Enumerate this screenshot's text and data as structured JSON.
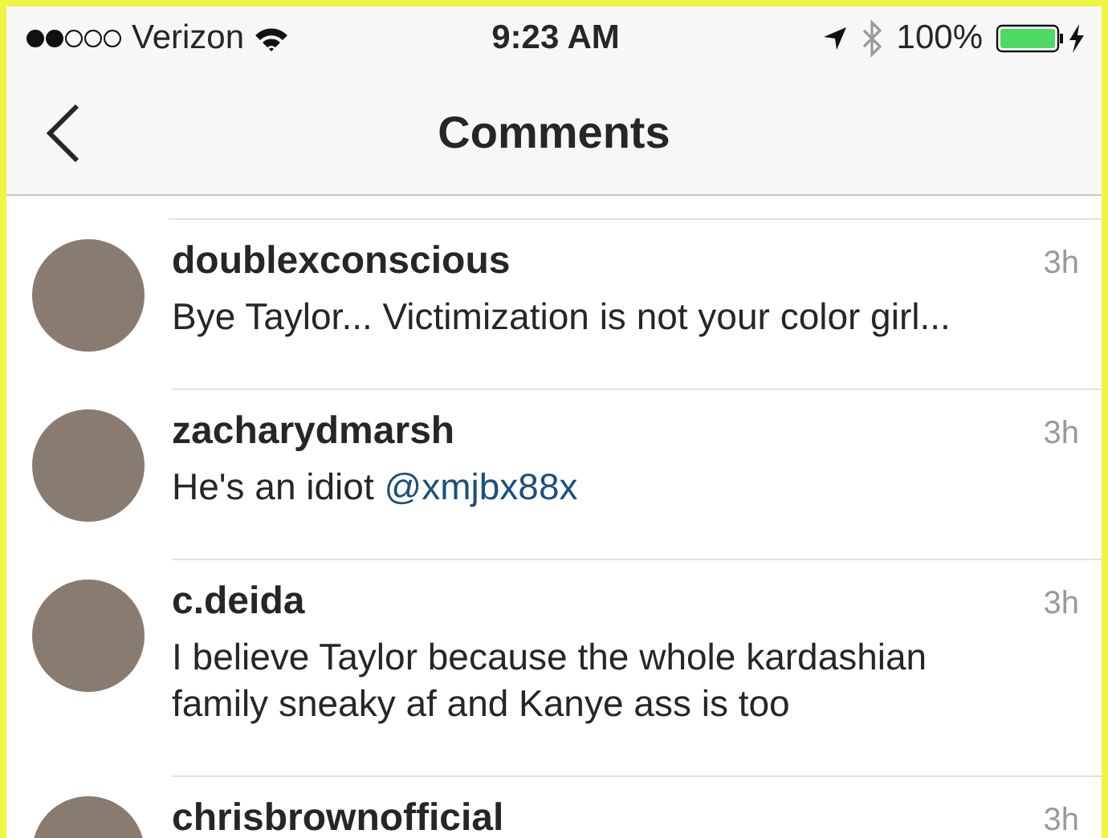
{
  "status_bar": {
    "carrier": "Verizon",
    "time": "9:23 AM",
    "battery": "100%"
  },
  "nav_bar": {
    "title": "Comments"
  },
  "comments": [
    {
      "username": "doublexconscious",
      "time": "3h",
      "parts": [
        {
          "kind": "text",
          "text": "Bye Taylor... Victimization is not your color girl..."
        }
      ]
    },
    {
      "username": "zacharydmarsh",
      "time": "3h",
      "parts": [
        {
          "kind": "text",
          "text": "He's an idiot "
        },
        {
          "kind": "mention",
          "text": "@xmjbx88x"
        }
      ]
    },
    {
      "username": "c.deida",
      "time": "3h",
      "parts": [
        {
          "kind": "text",
          "text": "I believe Taylor because the whole kardashian family sneaky af and Kanye ass is too"
        }
      ]
    },
    {
      "username": "chrisbrownofficial",
      "time": "3h"
    }
  ]
}
